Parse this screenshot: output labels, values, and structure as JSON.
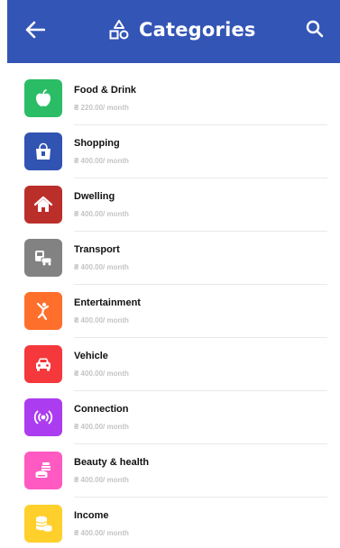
{
  "header": {
    "title": "Categories",
    "background": "#3355b6",
    "back_icon": "arrow-left-icon",
    "title_icon": "shapes-icon",
    "search_icon": "search-icon"
  },
  "categories": [
    {
      "name": "Food & Drink",
      "amount": "₴ 220.00/ month",
      "color": "#2bbd66",
      "icon": "apple-icon"
    },
    {
      "name": "Shopping",
      "amount": "₴ 400.00/ month",
      "color": "#3153b2",
      "icon": "shopping-bag-icon"
    },
    {
      "name": "Dwelling",
      "amount": "₴ 400.00/ month",
      "color": "#bb2f2b",
      "icon": "house-icon"
    },
    {
      "name": "Transport",
      "amount": "₴ 400.00/ month",
      "color": "#828282",
      "icon": "vehicles-icon"
    },
    {
      "name": "Entertainment",
      "amount": "₴ 400.00/ month",
      "color": "#ff6f2c",
      "icon": "dancer-icon"
    },
    {
      "name": "Vehicle",
      "amount": "₴ 400.00/ month",
      "color": "#f5383b",
      "icon": "car-icon"
    },
    {
      "name": "Connection",
      "amount": "₴ 400.00/ month",
      "color": "#ac3cf0",
      "icon": "signal-icon"
    },
    {
      "name": "Beauty & health",
      "amount": "₴ 400.00/ month",
      "color": "#ff59c2",
      "icon": "cosmetics-icon"
    },
    {
      "name": "Income",
      "amount": "₴ 400.00/ month",
      "color": "#ffd02c",
      "icon": "coins-icon"
    }
  ]
}
